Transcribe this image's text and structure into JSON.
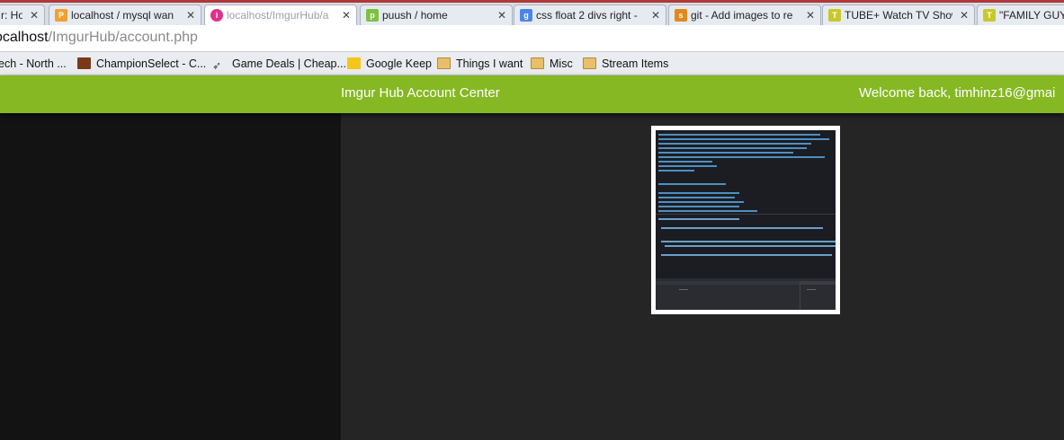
{
  "browser": {
    "tabs": [
      {
        "title": "r: Ho",
        "favicon": "generic-page-icon"
      },
      {
        "title": "localhost / mysql wan",
        "favicon": "phpmyadmin-icon"
      },
      {
        "title": "localhost/ImgurHub/a",
        "favicon": "imgur-icon"
      },
      {
        "title": "puush / home",
        "favicon": "puush-icon"
      },
      {
        "title": "css float 2 divs right -",
        "favicon": "google-icon"
      },
      {
        "title": "git - Add images to re",
        "favicon": "stackoverflow-icon"
      },
      {
        "title": "TUBE+ Watch TV Show",
        "favicon": "tubeplus-icon"
      },
      {
        "title": "\"FAMILY GUY",
        "favicon": "tubeplus-icon"
      }
    ],
    "address": {
      "host": "ocalhost",
      "path": "/ImgurHub/account.php"
    },
    "bookmarks": [
      {
        "label": "ech - North ...",
        "icon": "page-icon"
      },
      {
        "label": "ChampionSelect - C...",
        "icon": "champion-icon"
      },
      {
        "label": "Game Deals | Cheap...",
        "icon": "bird-icon"
      },
      {
        "label": "Google Keep",
        "icon": "keep-icon"
      },
      {
        "label": "Things I want",
        "icon": "folder-icon"
      },
      {
        "label": "Misc",
        "icon": "folder-icon"
      },
      {
        "label": "Stream Items",
        "icon": "folder-icon"
      }
    ]
  },
  "header": {
    "title": "Imgur Hub Account Center",
    "welcome": "Welcome back, timhinz16@gmai"
  },
  "gallery": {
    "thumbnail": "code-editor-screenshot-thumbnail"
  },
  "colors": {
    "accent": "#86b823",
    "background": "#252525",
    "sidebar": "#131313"
  }
}
